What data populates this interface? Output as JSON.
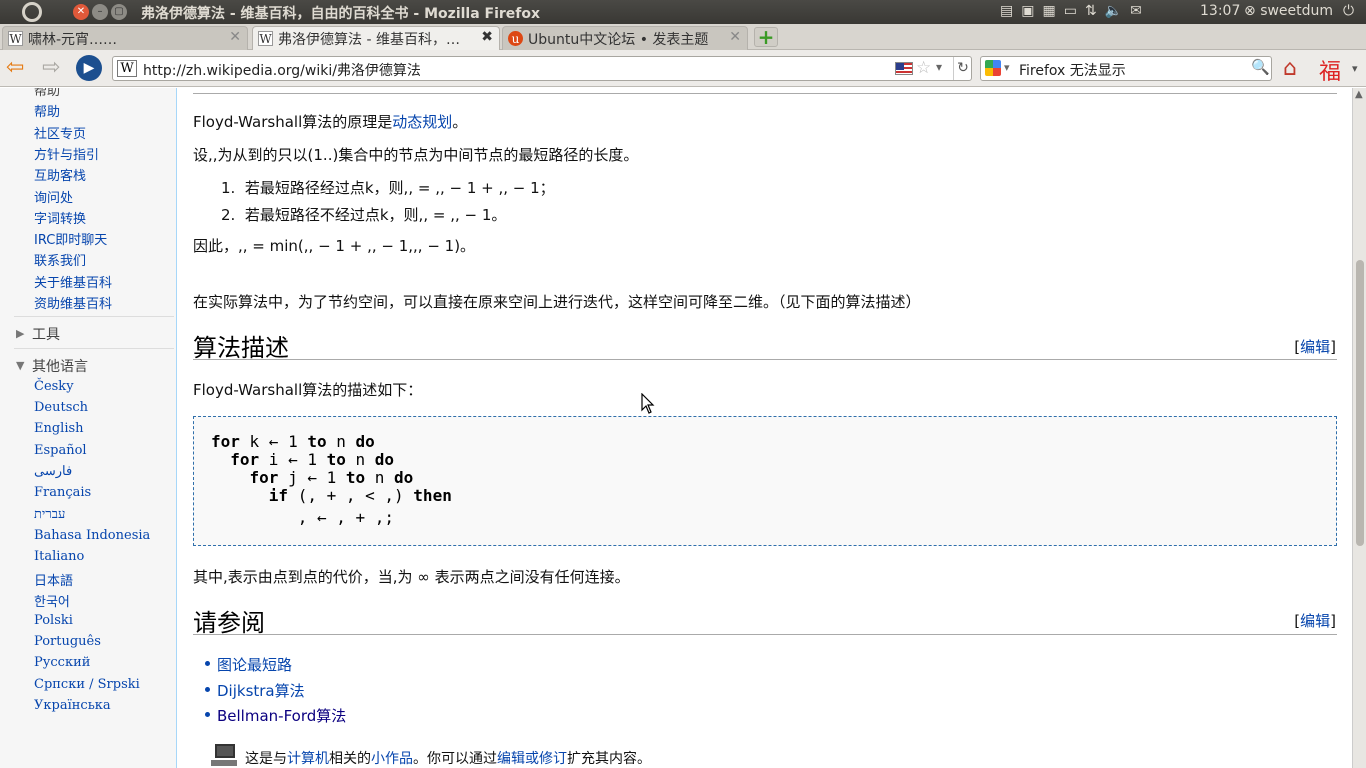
{
  "topbar": {
    "window_title": "弗洛伊德算法 - 维基百科，自由的百科全书 - Mozilla Firefox",
    "clock": "13:07",
    "user": "sweetdum",
    "close_glyph": "✕",
    "min_glyph": "–",
    "max_glyph": "▢",
    "indicator_icons": [
      "notes-icon",
      "battery-icon",
      "display-icon",
      "battery-level-icon",
      "network-icon",
      "volume-icon",
      "mail-icon"
    ],
    "user_icon": "close-circle-icon",
    "power_icon": "power-icon"
  },
  "tabs": [
    {
      "title": "啸林-元宵……",
      "icon": "W",
      "close": "✕"
    },
    {
      "title": "弗洛伊德算法 - 维基百科，…",
      "icon": "W",
      "close": "✖"
    },
    {
      "title": "Ubuntu中文论坛 • 发表主题",
      "icon": "u",
      "close": "✕"
    }
  ],
  "newtab_glyph": "+",
  "navbar": {
    "url": "http://zh.wikipedia.org/wiki/弗洛伊德算法",
    "url_site_icon": "W",
    "search_text": "Firefox 无法显示",
    "back_glyph": "⇦",
    "forward_glyph": "⇨",
    "reload_glyph": "↻",
    "home_glyph": "⌂",
    "fu_glyph": "福",
    "star_glyph": "☆",
    "drop_glyph": "▾",
    "search_glyph": "🔍",
    "play_glyph": "▶"
  },
  "sidebar": {
    "cut_head": "帮助",
    "help_links": [
      "帮助",
      "社区专页",
      "方针与指引",
      "互助客栈",
      "询问处",
      "字词转换",
      "IRC即时聊天",
      "联系我们",
      "关于维基百科",
      "资助维基百科"
    ],
    "tools_label": "工具",
    "langs_label": "其他语言",
    "languages": [
      "Česky",
      "Deutsch",
      "English",
      "Español",
      "فارسی",
      "Français",
      "עברית",
      "Bahasa Indonesia",
      "Italiano",
      "日本語",
      "한국어",
      "Polski",
      "Português",
      "Русский",
      "Српски / Srpski",
      "Українська"
    ],
    "tri_closed": "▶",
    "tri_open": "▼"
  },
  "article": {
    "p1_pre": "Floyd-Warshall算法的原理是",
    "p1_link": "动态规划",
    "p1_post": "。",
    "p2": "设,,为从到的只以(1..)集合中的节点为中间节点的最短路径的长度。",
    "ol": [
      {
        "num": "1.",
        "text": "若最短路径经过点k，则,, = ,, − 1 + ,, − 1；"
      },
      {
        "num": "2.",
        "text": "若最短路径不经过点k，则,, = ,, − 1。"
      }
    ],
    "p3": "因此，,, = min(,, − 1 + ,, − 1,,, − 1)。",
    "p4": "在实际算法中，为了节约空间，可以直接在原来空间上进行迭代，这样空间可降至二维。（见下面的算法描述）",
    "h2_algo": "算法描述",
    "edit_label": "编辑",
    "p5": "Floyd-Warshall算法的描述如下：",
    "code": [
      {
        "kw1": "for",
        "mid1": " k ← 1 ",
        "kw2": "to",
        "mid2": " n ",
        "kw3": "do",
        "indent": ""
      },
      {
        "kw1": "for",
        "mid1": " i ← 1 ",
        "kw2": "to",
        "mid2": " n ",
        "kw3": "do",
        "indent": "  "
      },
      {
        "kw1": "for",
        "mid1": " j ← 1 ",
        "kw2": "to",
        "mid2": " n ",
        "kw3": "do",
        "indent": "    "
      },
      {
        "kw1": "if",
        "mid1": " (, + , < ,) ",
        "kw2": "then",
        "mid2": "",
        "kw3": "",
        "indent": "      "
      }
    ],
    "code_last": "         , ← , + ,;",
    "p6": "其中,表示由点到点的代价，当,为 ∞ 表示两点之间没有任何连接。",
    "h2_see": "请参阅",
    "see_also": [
      "图论最短路",
      "Dijkstra算法",
      "Bellman-Ford算法"
    ],
    "stub_pre": "这是与",
    "stub_link1": "计算机",
    "stub_mid": "相关的",
    "stub_link2": "小作品",
    "stub_mid2": "。你可以通过",
    "stub_link3": "编辑或修订",
    "stub_post": "扩充其内容。"
  },
  "colors": {
    "link": "#0645ad",
    "visited": "#0b0080",
    "close": "#e0593a"
  }
}
